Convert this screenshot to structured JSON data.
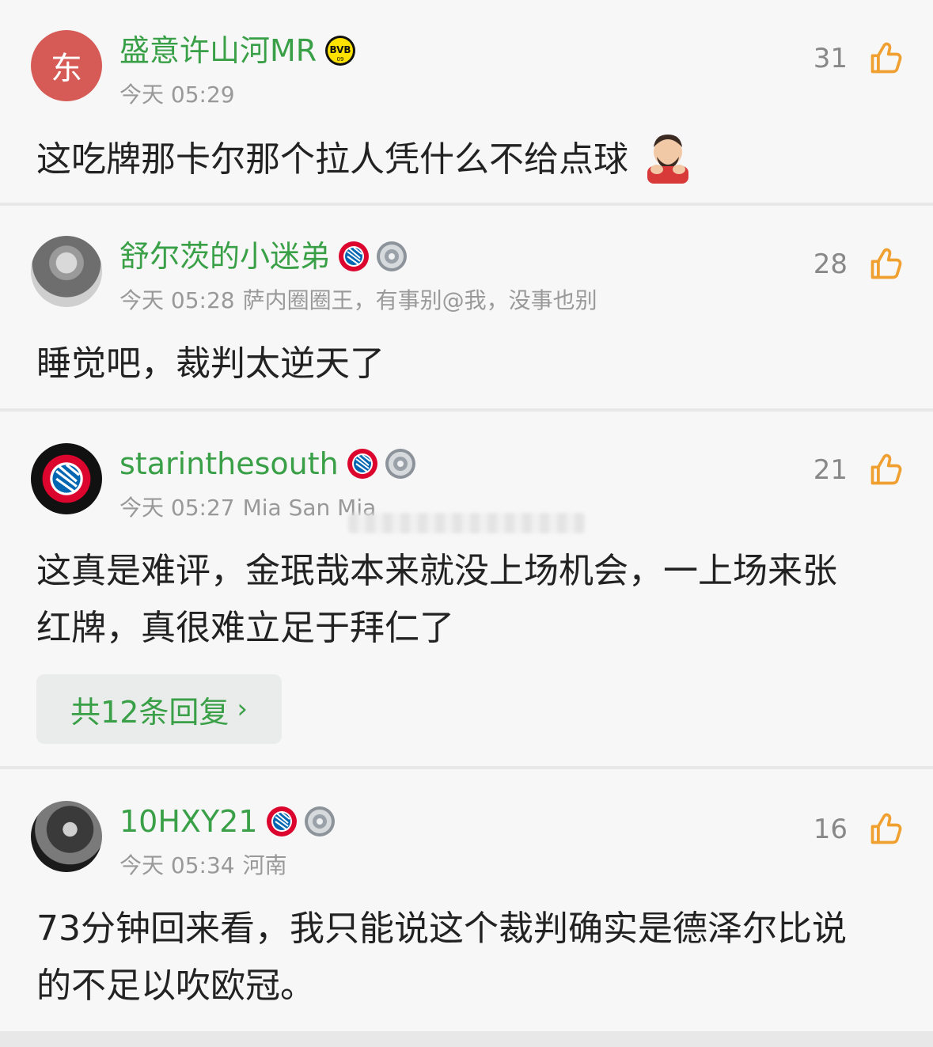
{
  "comments": [
    {
      "username": "盛意许山河MR",
      "avatar_text": "东",
      "time": "今天 05:29",
      "location": "",
      "signature": "",
      "likes": "31",
      "text": "这吃牌那卡尔那个拉人凭什么不给点球",
      "badges": [
        "bvb-badge"
      ]
    },
    {
      "username": "舒尔茨的小迷弟",
      "time": "今天 05:28",
      "location": "",
      "signature": "萨内圈圈王，有事别@我，没事也别",
      "likes": "28",
      "text": "睡觉吧，裁判太逆天了",
      "badges": [
        "bayern-badge",
        "trophy-badge"
      ]
    },
    {
      "username": "starinthesouth",
      "time": "今天 05:27",
      "location": "",
      "signature": "Mia San Mia",
      "likes": "21",
      "text_line1": "这真是难评，金珉哉本来就没上场机会，一上场来张",
      "text_line2": "红牌，真很难立足于拜仁了",
      "replies": "共12条回复",
      "badges": [
        "bayern-badge",
        "trophy-badge"
      ]
    },
    {
      "username": "10HXY21",
      "time": "今天 05:34",
      "location": "河南",
      "signature": "",
      "likes": "16",
      "text_line1": "73分钟回来看，我只能说这个裁判确实是德泽尔比说",
      "text_line2": "的不足以吹欧冠。",
      "badges": [
        "bayern-badge",
        "trophy-badge"
      ]
    }
  ],
  "colors": {
    "username_green": "#3aa048",
    "like_orange": "#f0a030",
    "meta_gray": "#999999"
  }
}
